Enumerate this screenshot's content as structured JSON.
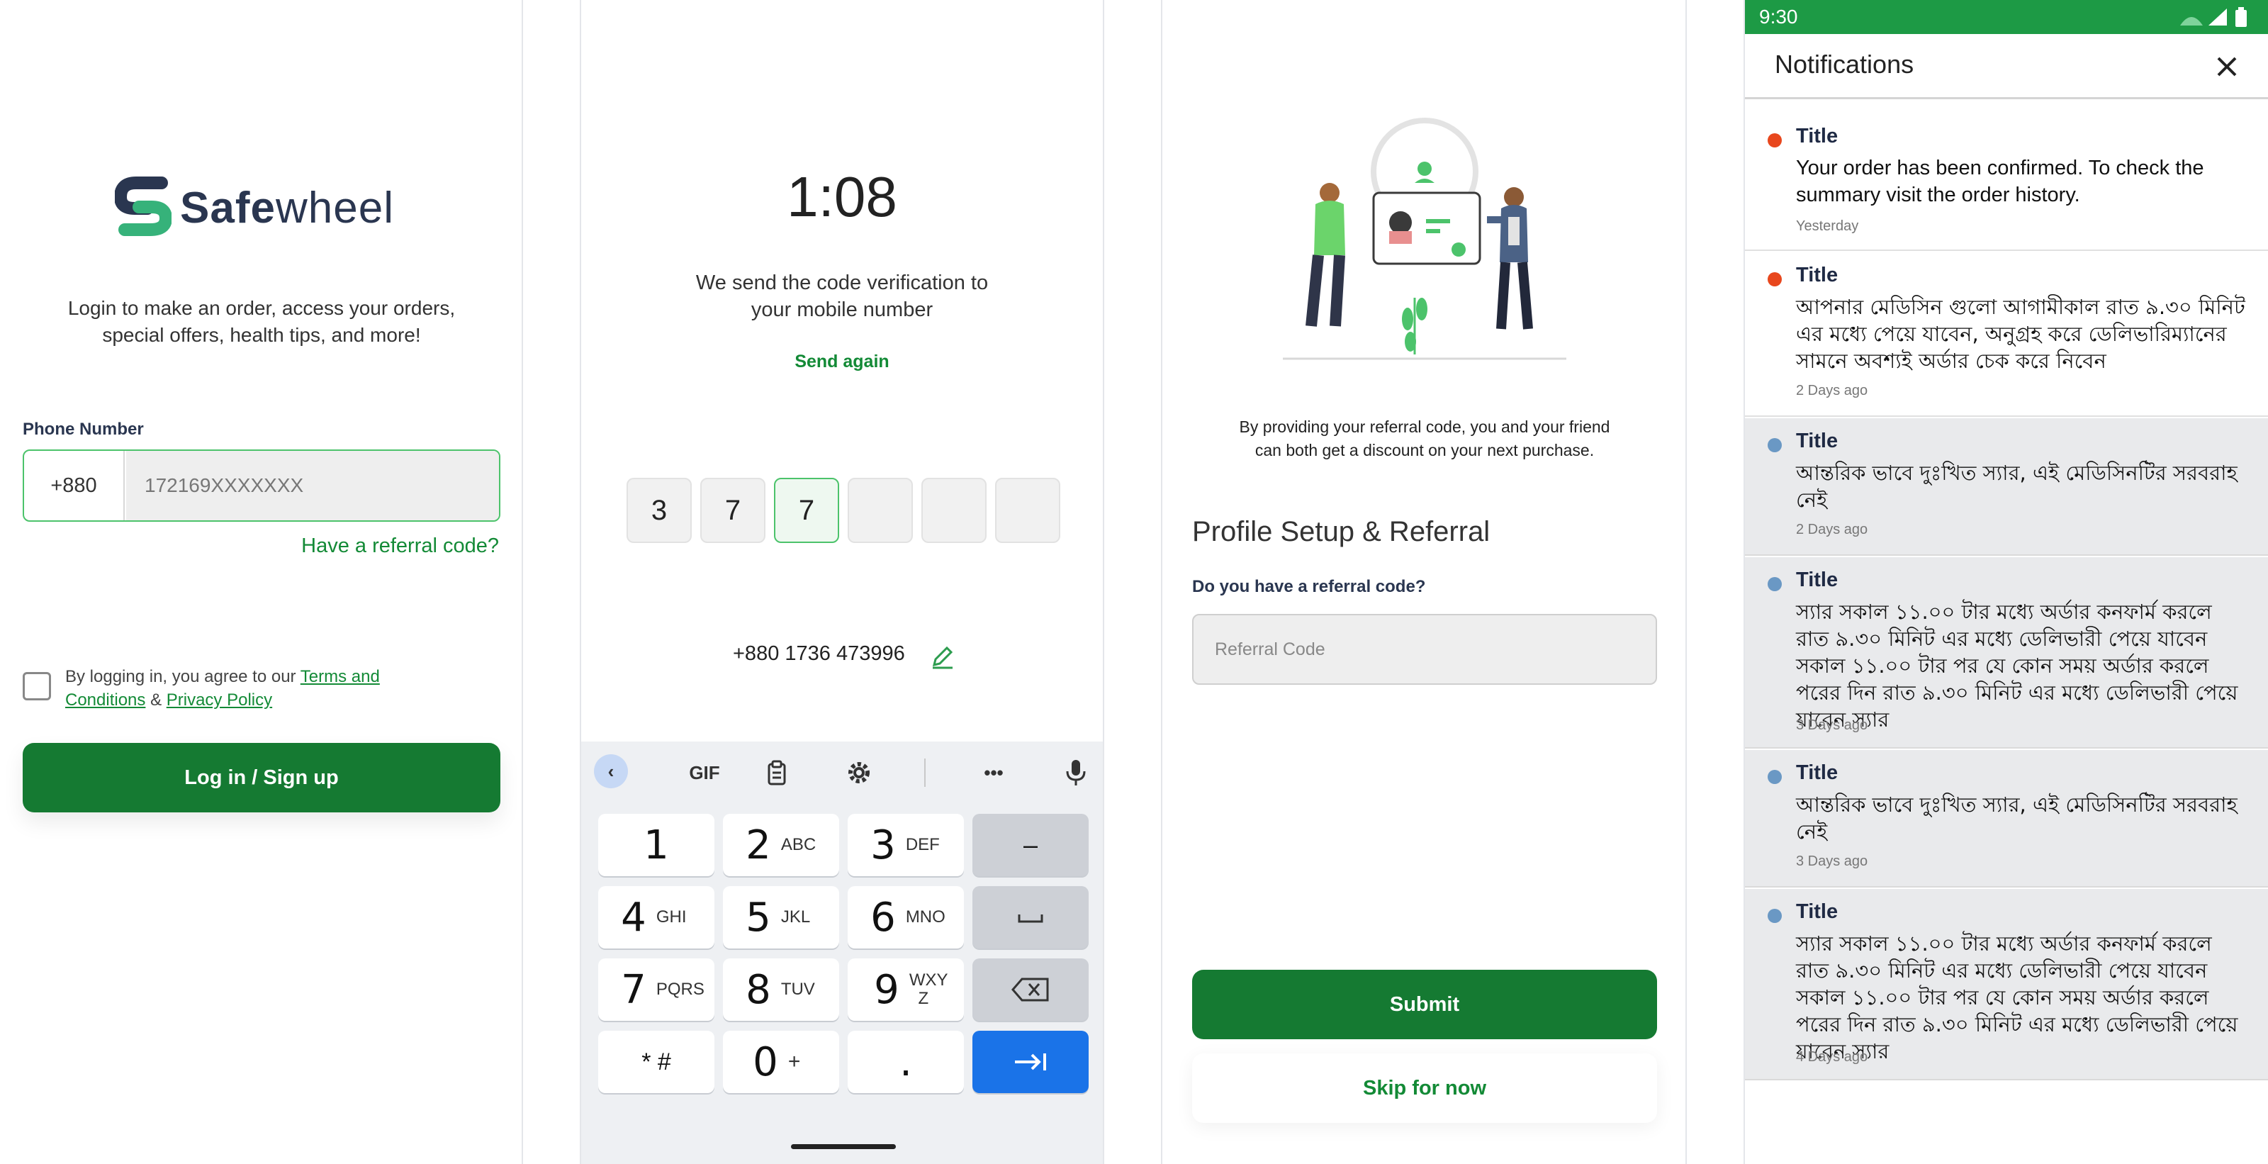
{
  "login": {
    "brand": "Safewheel",
    "brand_bold": "Safe",
    "brand_light": "wheel",
    "tagline_line1": "Login to make an order, access your orders,",
    "tagline_line2": "special offers, health tips, and more!",
    "phone_label": "Phone Number",
    "country_code": "+880",
    "phone_value": "172169XXXXXXX",
    "referral_link": "Have a referral code?",
    "terms_prefix": "By logging in, you agree to our ",
    "terms_link": "Terms and Conditions",
    "terms_amp": " & ",
    "privacy_link": "Privacy Policy",
    "login_button": "Log in / Sign up"
  },
  "otp": {
    "timer": "1:08",
    "message_line1": "We send the code verification to",
    "message_line2": "your mobile number",
    "send_again": "Send again",
    "digits": [
      "3",
      "7",
      "7",
      "",
      "",
      ""
    ],
    "phone": "+880 1736 473996",
    "keyboard": {
      "toolbar_gif": "GIF",
      "keys": [
        {
          "num": "1",
          "letters": ""
        },
        {
          "num": "2",
          "letters": "ABC"
        },
        {
          "num": "3",
          "letters": "DEF"
        },
        {
          "num": "4",
          "letters": "GHI"
        },
        {
          "num": "5",
          "letters": "JKL"
        },
        {
          "num": "6",
          "letters": "MNO"
        },
        {
          "num": "7",
          "letters": "PQRS"
        },
        {
          "num": "8",
          "letters": "TUV"
        },
        {
          "num": "9",
          "letters": "WXY Z"
        },
        {
          "num": "* #",
          "letters": ""
        },
        {
          "num": "0",
          "letters": "+"
        },
        {
          "num": ".",
          "letters": ""
        }
      ],
      "minus": "–"
    }
  },
  "referral": {
    "description_line1": "By providing your referral code, you and your friend",
    "description_line2": "can both get a discount on your next purchase.",
    "heading": "Profile Setup & Referral",
    "question": "Do you have a referral code?",
    "placeholder": "Referral Code",
    "submit": "Submit",
    "skip": "Skip for now"
  },
  "notifications": {
    "status_time": "9:30",
    "title": "Notifications",
    "items": [
      {
        "title": "Title",
        "body": "Your order has been confirmed. To check the summary visit the order history.",
        "time": "Yesterday",
        "dot": "#e8471d"
      },
      {
        "title": "Title",
        "body": "আপনার মেডিসিন গুলো আগামীকাল রাত ৯.৩০ মিনিট এর মধ্যে পেয়ে যাবেন, অনুগ্রহ করে ডেলিভারিম্যানের সামনে অবশ্যই অর্ডার চেক করে নিবেন",
        "time": "2 Days ago",
        "dot": "#e8471d"
      },
      {
        "title": "Title",
        "body": "আন্তরিক ভাবে দুঃখিত স্যার, এই মেডিসিনটির সরবরাহ নেই",
        "time": "2 Days ago",
        "dot": "#6a98c4"
      },
      {
        "title": "Title",
        "body": "স্যার সকাল ১১.০০ টার মধ্যে অর্ডার কনফার্ম করলে রাত ৯.৩০ মিনিট এর মধ্যে ডেলিভারী পেয়ে যাবেন   সকাল ১১.০০ টার পর যে কোন সময় অর্ডার করলে পরের দিন রাত ৯.৩০ মিনিট এর মধ্যে ডেলিভারী পেয়ে যাবেন স্যার",
        "time": "3 Days ago",
        "dot": "#6a98c4"
      },
      {
        "title": "Title",
        "body": "আন্তরিক ভাবে দুঃখিত স্যার, এই মেডিসিনটির সরবরাহ নেই",
        "time": "3 Days ago",
        "dot": "#6a98c4"
      },
      {
        "title": "Title",
        "body": "স্যার সকাল ১১.০০ টার মধ্যে অর্ডার কনফার্ম করলে রাত ৯.৩০ মিনিট এর মধ্যে ডেলিভারী পেয়ে যাবেন   সকাল ১১.০০ টার পর যে কোন সময় অর্ডার করলে পরের দিন রাত ৯.৩০ মিনিট এর মধ্যে ডেলিভারী পেয়ে যাবেন স্যার",
        "time": "4 Days ago",
        "dot": "#6a98c4"
      }
    ]
  },
  "colors": {
    "brand_green": "#157a32",
    "accent_green": "#138a36",
    "status_bar": "#1d9a45",
    "keyboard_blue": "#1a73e8"
  }
}
